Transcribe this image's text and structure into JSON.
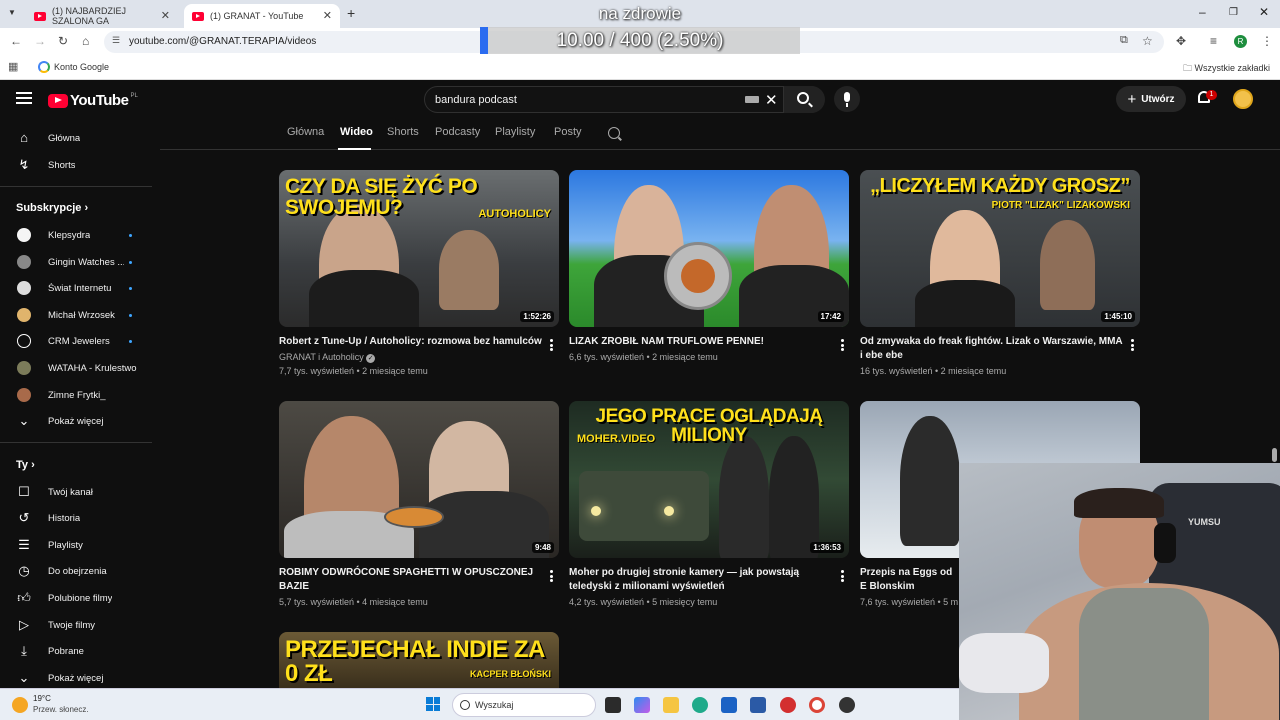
{
  "browser": {
    "tabs": [
      {
        "title": "(1) NAJBARDZIEJ SZALONA GA"
      },
      {
        "title": "(1) GRANAT - YouTube"
      }
    ],
    "url": "youtube.com/@GRANAT.TERAPIA/videos",
    "bookmarks": {
      "google": "Konto Google",
      "all": "Wszystkie zakładki"
    }
  },
  "overlay": {
    "title": "na zdrowie",
    "value": "10.00 / 400 (2.50%)",
    "progress_percent": 2.5
  },
  "youtube": {
    "logo_text": "YouTube",
    "country": "PL",
    "search_value": "bandura podcast",
    "create_label": "Utwórz",
    "notification_count": "1"
  },
  "sidebar": {
    "main": [
      {
        "label": "Główna",
        "icon": "home-icon"
      },
      {
        "label": "Shorts",
        "icon": "shorts-icon"
      }
    ],
    "subscriptions_header": "Subskrypcje",
    "subscriptions": [
      {
        "label": "Klepsydra"
      },
      {
        "label": "Gingin Watches ..."
      },
      {
        "label": "Świat Internetu"
      },
      {
        "label": "Michał Wrzosek"
      },
      {
        "label": "CRM Jewelers"
      },
      {
        "label": "WATAHA - Krulestwo"
      },
      {
        "label": "Zimne Frytki_"
      }
    ],
    "show_more": "Pokaż więcej",
    "you_header": "Ty",
    "you": [
      {
        "label": "Twój kanał",
        "icon": "channel-icon"
      },
      {
        "label": "Historia",
        "icon": "history-icon"
      },
      {
        "label": "Playlisty",
        "icon": "playlists-icon"
      },
      {
        "label": "Do obejrzenia",
        "icon": "watch-later-icon"
      },
      {
        "label": "Polubione filmy",
        "icon": "liked-icon"
      },
      {
        "label": "Twoje filmy",
        "icon": "your-videos-icon"
      },
      {
        "label": "Pobrane",
        "icon": "download-icon"
      },
      {
        "label": "Pokaż więcej",
        "icon": "chevron-down-icon"
      }
    ]
  },
  "channel_tabs": [
    "Główna",
    "Wideo",
    "Shorts",
    "Podcasty",
    "Playlisty",
    "Posty"
  ],
  "videos": [
    {
      "thumb_text": "CZY DA SIĘ ŻYĆ PO SWOJEMU?",
      "thumb_sub": "AUTOHOLICY",
      "duration": "1:52:26",
      "title": "Robert z Tune-Up / Autoholicy: rozmowa bez hamulców",
      "channel": "GRANAT i Autoholicy",
      "meta": "7,7 tys. wyświetleń • 2 miesiące temu"
    },
    {
      "thumb_text": "",
      "thumb_sub": "",
      "duration": "17:42",
      "title": "LIZAK ZROBIŁ NAM TRUFLOWE PENNE!",
      "channel": "",
      "meta": "6,6 tys. wyświetleń • 2 miesiące temu"
    },
    {
      "thumb_text": "„LICZYŁEM KAŻDY GROSZ”",
      "thumb_sub": "PIOTR \"LIZAK\" LIZAKOWSKI",
      "duration": "1:45:10",
      "title": "Od zmywaka do freak fightów. Lizak o Warszawie, MMA i ebe ebe",
      "channel": "",
      "meta": "16 tys. wyświetleń • 2 miesiące temu"
    },
    {
      "thumb_text": "",
      "thumb_sub": "",
      "duration": "9:48",
      "title": "ROBIMY ODWRÓCONE SPAGHETTI W OPUSCZONEJ BAZIE",
      "channel": "",
      "meta": "5,7 tys. wyświetleń • 4 miesiące temu"
    },
    {
      "thumb_text": "JEGO PRACE OGLĄDAJĄ MILIONY",
      "thumb_sub": "MOHER.VIDEO",
      "duration": "1:36:53",
      "title": "Moher po drugiej stronie kamery — jak powstają teledyski z milionami wyświetleń",
      "channel": "",
      "meta": "4,2 tys. wyświetleń • 5 miesięcy temu"
    },
    {
      "thumb_text": "",
      "thumb_sub": "",
      "duration": "",
      "title": "Przepis na Eggs od E Blonskim",
      "channel": "",
      "meta": "7,6 tys. wyświetleń • 5 m"
    },
    {
      "thumb_text": "PRZEJECHAŁ INDIE ZA 0 ZŁ",
      "thumb_sub": "KACPER BŁOŃSKI",
      "duration": "",
      "title": "",
      "channel": "",
      "meta": ""
    }
  ],
  "webcam": {
    "shirt_text": "YUMSU"
  },
  "taskbar": {
    "temp": "19°C",
    "desc": "Przew. słonecz.",
    "search": "Wyszukaj"
  }
}
